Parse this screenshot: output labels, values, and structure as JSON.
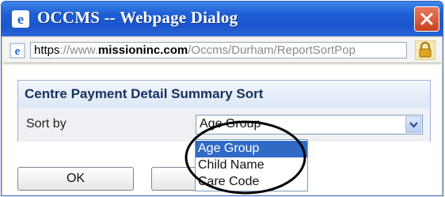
{
  "window": {
    "title": "OCCMS -- Webpage Dialog"
  },
  "address": {
    "scheme": "https",
    "host_prefix": "://www.",
    "host_domain": "missioninc.com",
    "path": "/Occms/Durham/ReportSortPop"
  },
  "panel": {
    "title": "Centre Payment Detail Summary Sort"
  },
  "sort": {
    "label": "Sort by",
    "selected": "Age Group",
    "options": [
      "Age Group",
      "Child Name",
      "Care Code"
    ]
  },
  "buttons": {
    "ok": "OK",
    "cancel": ""
  },
  "icons": {
    "app": "ie-icon",
    "close": "close-icon",
    "lock": "lock-icon",
    "dropdown": "chevron-down-icon"
  },
  "colors": {
    "titlebar": "#1f5fd6",
    "close_button": "#d9532f",
    "selection": "#316ac5"
  }
}
